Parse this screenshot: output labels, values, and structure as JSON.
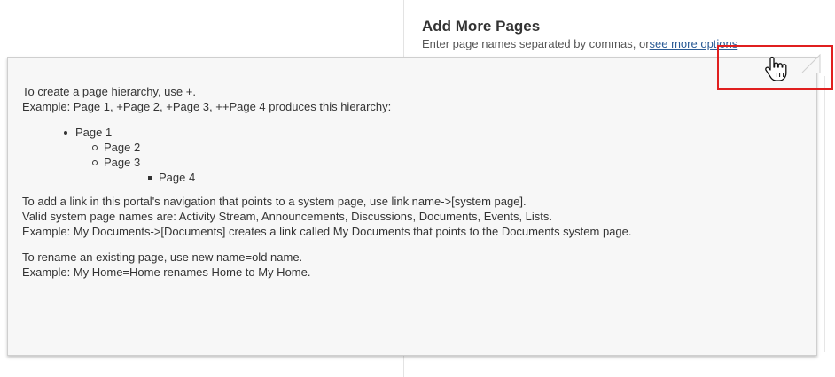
{
  "header": {
    "title": "Add More Pages",
    "subtitle_prefix": "Enter page names separated by commas, or",
    "see_more_link": "see more options"
  },
  "tooltip": {
    "intro_line1": "To create a page hierarchy, use +.",
    "intro_line2": "Example: Page 1, +Page 2, +Page 3, ++Page 4 produces this hierarchy:",
    "hierarchy": [
      {
        "label": "Page 1",
        "level": 1
      },
      {
        "label": "Page 2",
        "level": 2
      },
      {
        "label": "Page 3",
        "level": 2
      },
      {
        "label": "Page 4",
        "level": 3
      }
    ],
    "link_line1": "To add a link in this portal's navigation that points to a system page, use link name->[system page].",
    "link_line2": "Valid system page names are: Activity Stream, Announcements, Discussions, Documents, Events, Lists.",
    "link_line3": "Example: My Documents->[Documents] creates a link called My Documents that points to the Documents system page.",
    "rename_line1": "To rename an existing page, use new name=old name.",
    "rename_line2": "Example: My Home=Home renames Home to My Home."
  },
  "colors": {
    "highlight": "#e01f1f",
    "link": "#2b5b95",
    "tooltip_bg": "#f7f7f7"
  },
  "icons": {
    "cursor": "hand-pointer-cursor-icon"
  }
}
